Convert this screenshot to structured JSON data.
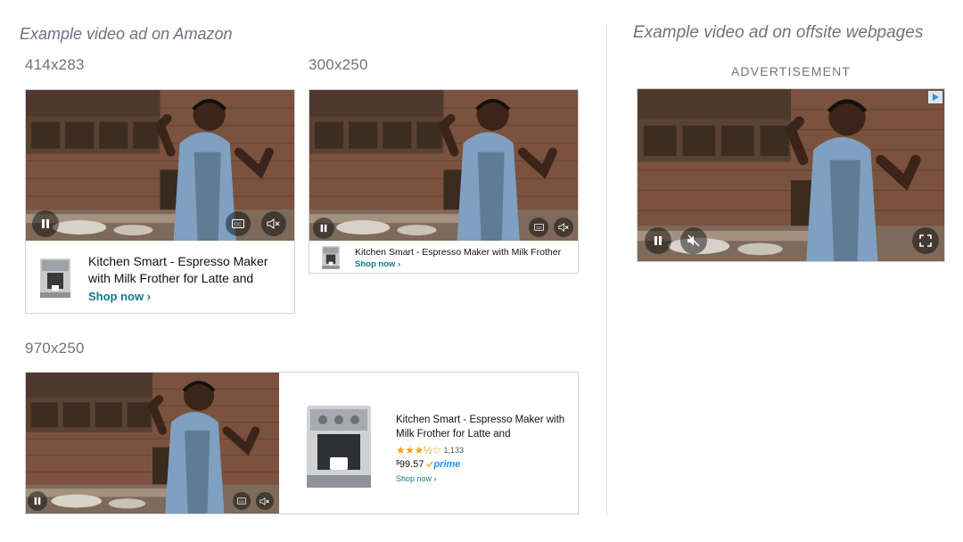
{
  "amazon_heading": "Example video ad on Amazon",
  "offsite_heading": "Example video ad on offsite webpages",
  "advertisement_label": "ADVERTISEMENT",
  "sizes": {
    "s414": "414x283",
    "s300": "300x250",
    "s970": "970x250"
  },
  "product": {
    "title_short": "Kitchen Smart - Espresso Maker with Milk Frother for Latte and",
    "title_one_line": "Kitchen Smart - Espresso Maker with Milk Frother",
    "title_970": "Kitchen Smart - Espresso Maker with Milk Frother for Latte and",
    "shop_now": "Shop now ›",
    "rating_stars": "★★★½☆",
    "review_count": "1,133",
    "price_dollar": "$",
    "price_value": "99.57",
    "prime": "prime"
  },
  "icons": {
    "pause": "pause-icon",
    "captions": "closed-captions-icon",
    "mute": "mute-icon",
    "fullscreen": "fullscreen-icon",
    "adchoices": "adchoices-icon"
  },
  "colors": {
    "shop_link": "#0f7a8a",
    "stars": "#f0a21a",
    "prime": "#1a98ff"
  }
}
